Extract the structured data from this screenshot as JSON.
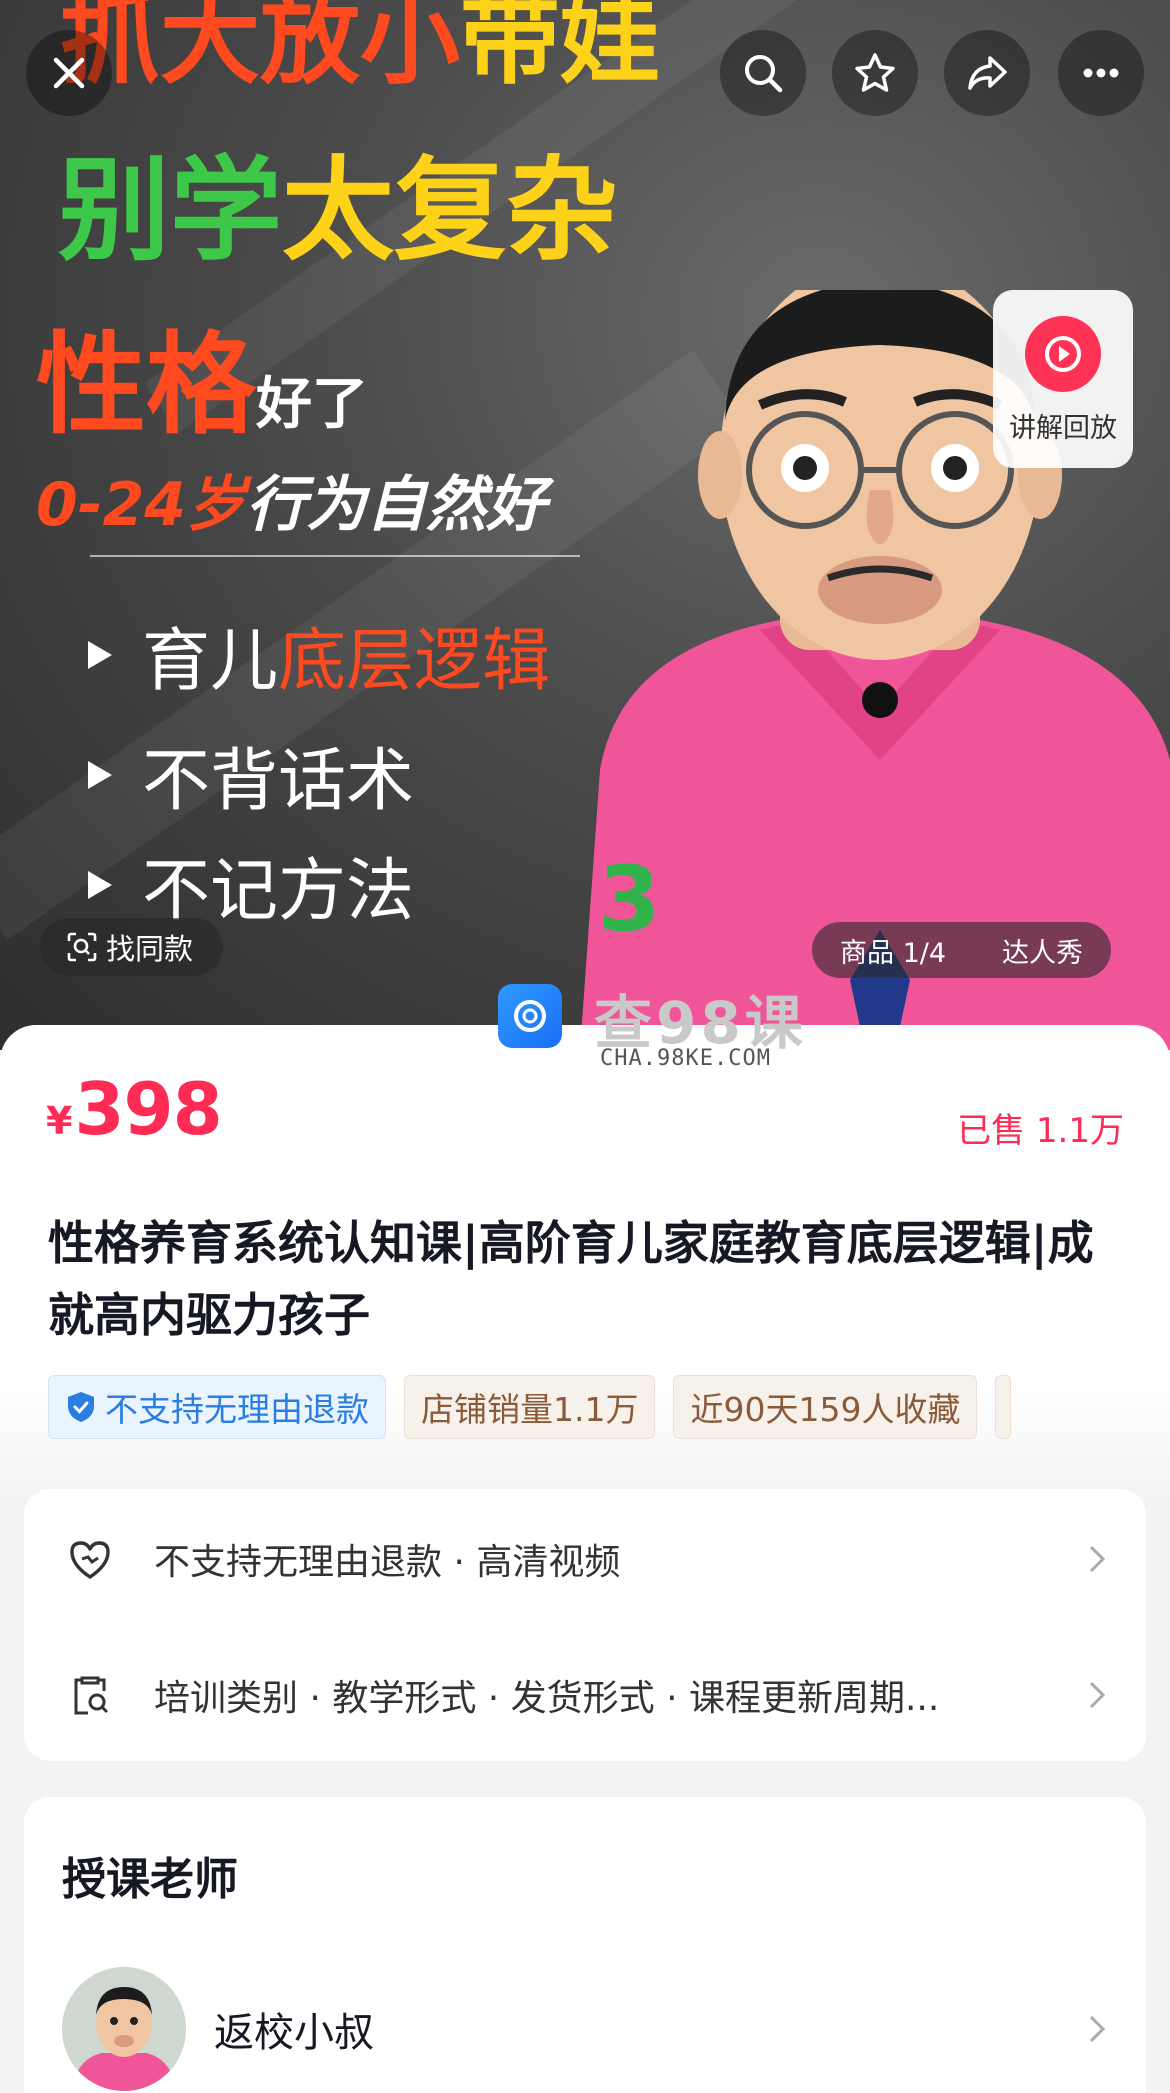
{
  "hero": {
    "line1_red": "抓大放小",
    "line1_yellow": "带娃",
    "line2_green": "别学",
    "line2_yellow": "太复杂",
    "line3_big": "性格",
    "line3_small": "好了",
    "line4_red": "0-24岁",
    "line4_white": "行为自然好",
    "bullets": [
      {
        "prefix": "育儿",
        "highlight": "底层逻辑"
      },
      {
        "prefix": "不背话术",
        "highlight": ""
      },
      {
        "prefix": "不记方法",
        "highlight": ""
      }
    ],
    "find_same_label": "找同款",
    "product_counter": "商品 1/4",
    "influencer_tab": "达人秀",
    "replay_label": "讲解回放",
    "shirt_number": "3"
  },
  "top_icons": [
    "close-icon",
    "search-icon",
    "star-icon",
    "share-icon",
    "more-icon"
  ],
  "watermark": {
    "main": "查98课",
    "sub": "CHA.98KE.COM"
  },
  "product": {
    "currency": "¥",
    "price": "398",
    "sold": "已售 1.1万",
    "title": "性格养育系统认知课|高阶育儿家庭教育底层逻辑|成就高内驱力孩子",
    "tags": [
      "不支持无理由退款",
      "店铺销量1.1万",
      "近90天159人收藏"
    ]
  },
  "services": [
    {
      "icon": "heart-shield-icon",
      "label": "不支持无理由退款 · 高清视频"
    },
    {
      "icon": "clipboard-search-icon",
      "label": "培训类别 · 教学形式 · 发货形式 · 课程更新周期..."
    }
  ],
  "teacher": {
    "section_title": "授课老师",
    "name": "返校小叔"
  },
  "colors": {
    "accent": "#fe2c55",
    "tag_blue": "#2a7de1",
    "tag_beige": "#8a5a3a",
    "hero_red": "#ff4a1f",
    "hero_yellow": "#ffd21a",
    "hero_green": "#3ec84a",
    "shirt_pink": "#f0559a"
  }
}
